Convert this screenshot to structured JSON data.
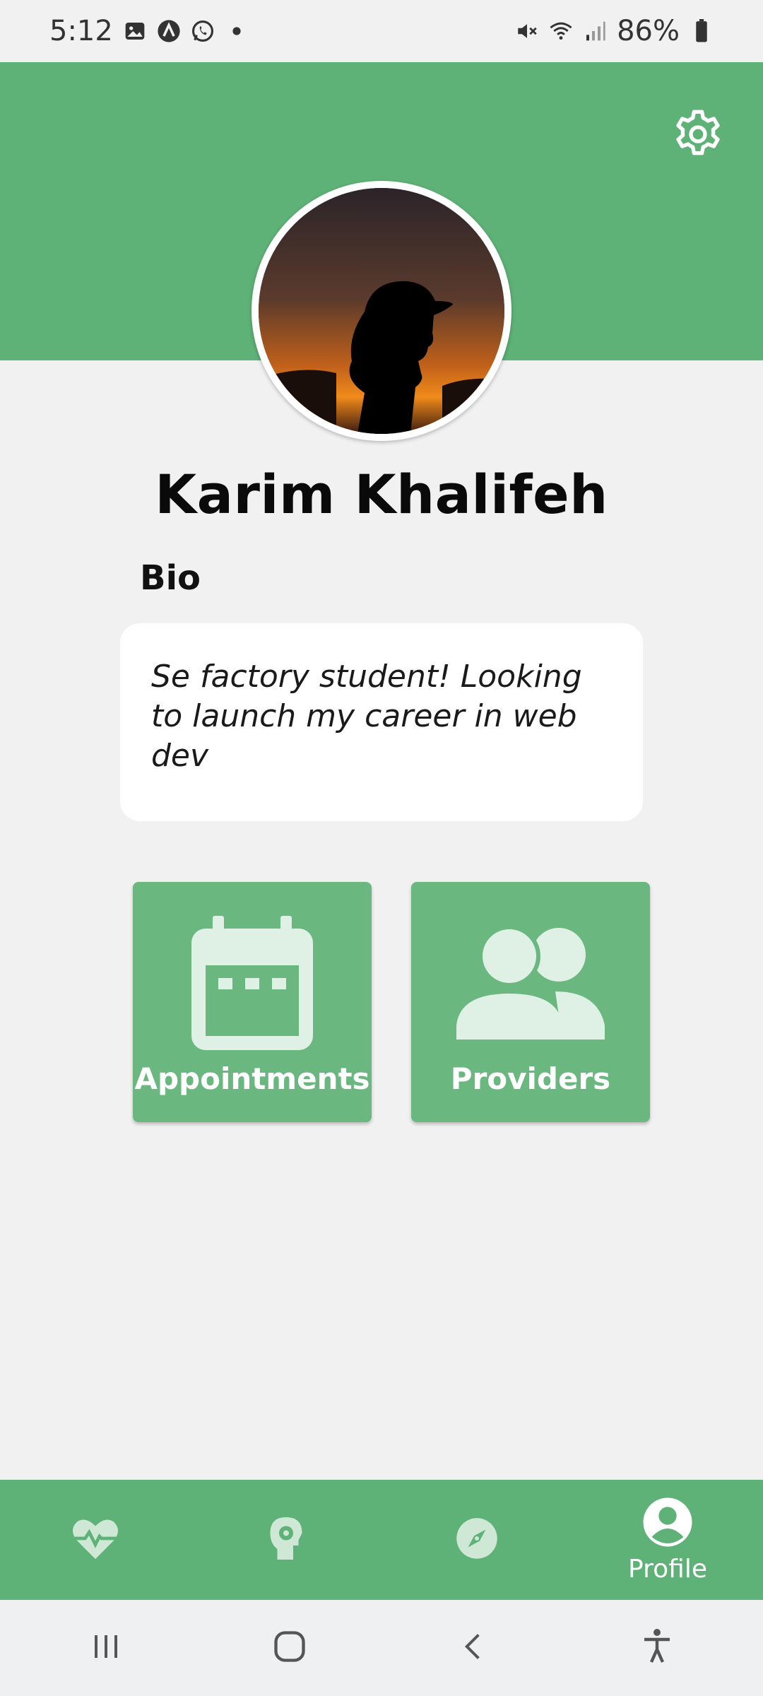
{
  "status_bar": {
    "time": "5:12",
    "battery": "86%",
    "icons_left": [
      "gallery-icon",
      "app-icon",
      "whatsapp-icon",
      "dot-icon"
    ],
    "icons_right": [
      "mute-icon",
      "wifi-icon",
      "signal-icon",
      "battery-icon"
    ]
  },
  "profile": {
    "name": "Karim Khalifeh",
    "bio_label": "Bio",
    "bio_text": "Se factory student! Looking to launch my career in web dev"
  },
  "tiles": [
    {
      "label": "Appointments",
      "icon": "calendar-icon"
    },
    {
      "label": "Providers",
      "icon": "people-icon"
    }
  ],
  "bottom_nav": {
    "items": [
      {
        "icon": "heart-pulse-icon",
        "label": ""
      },
      {
        "icon": "head-gear-icon",
        "label": ""
      },
      {
        "icon": "compass-icon",
        "label": ""
      },
      {
        "icon": "profile-icon",
        "label": "Profile"
      }
    ],
    "active_index": 3
  },
  "colors": {
    "primary": "#5eb277",
    "tile": "#6ab880",
    "background": "#f1f1f2"
  }
}
